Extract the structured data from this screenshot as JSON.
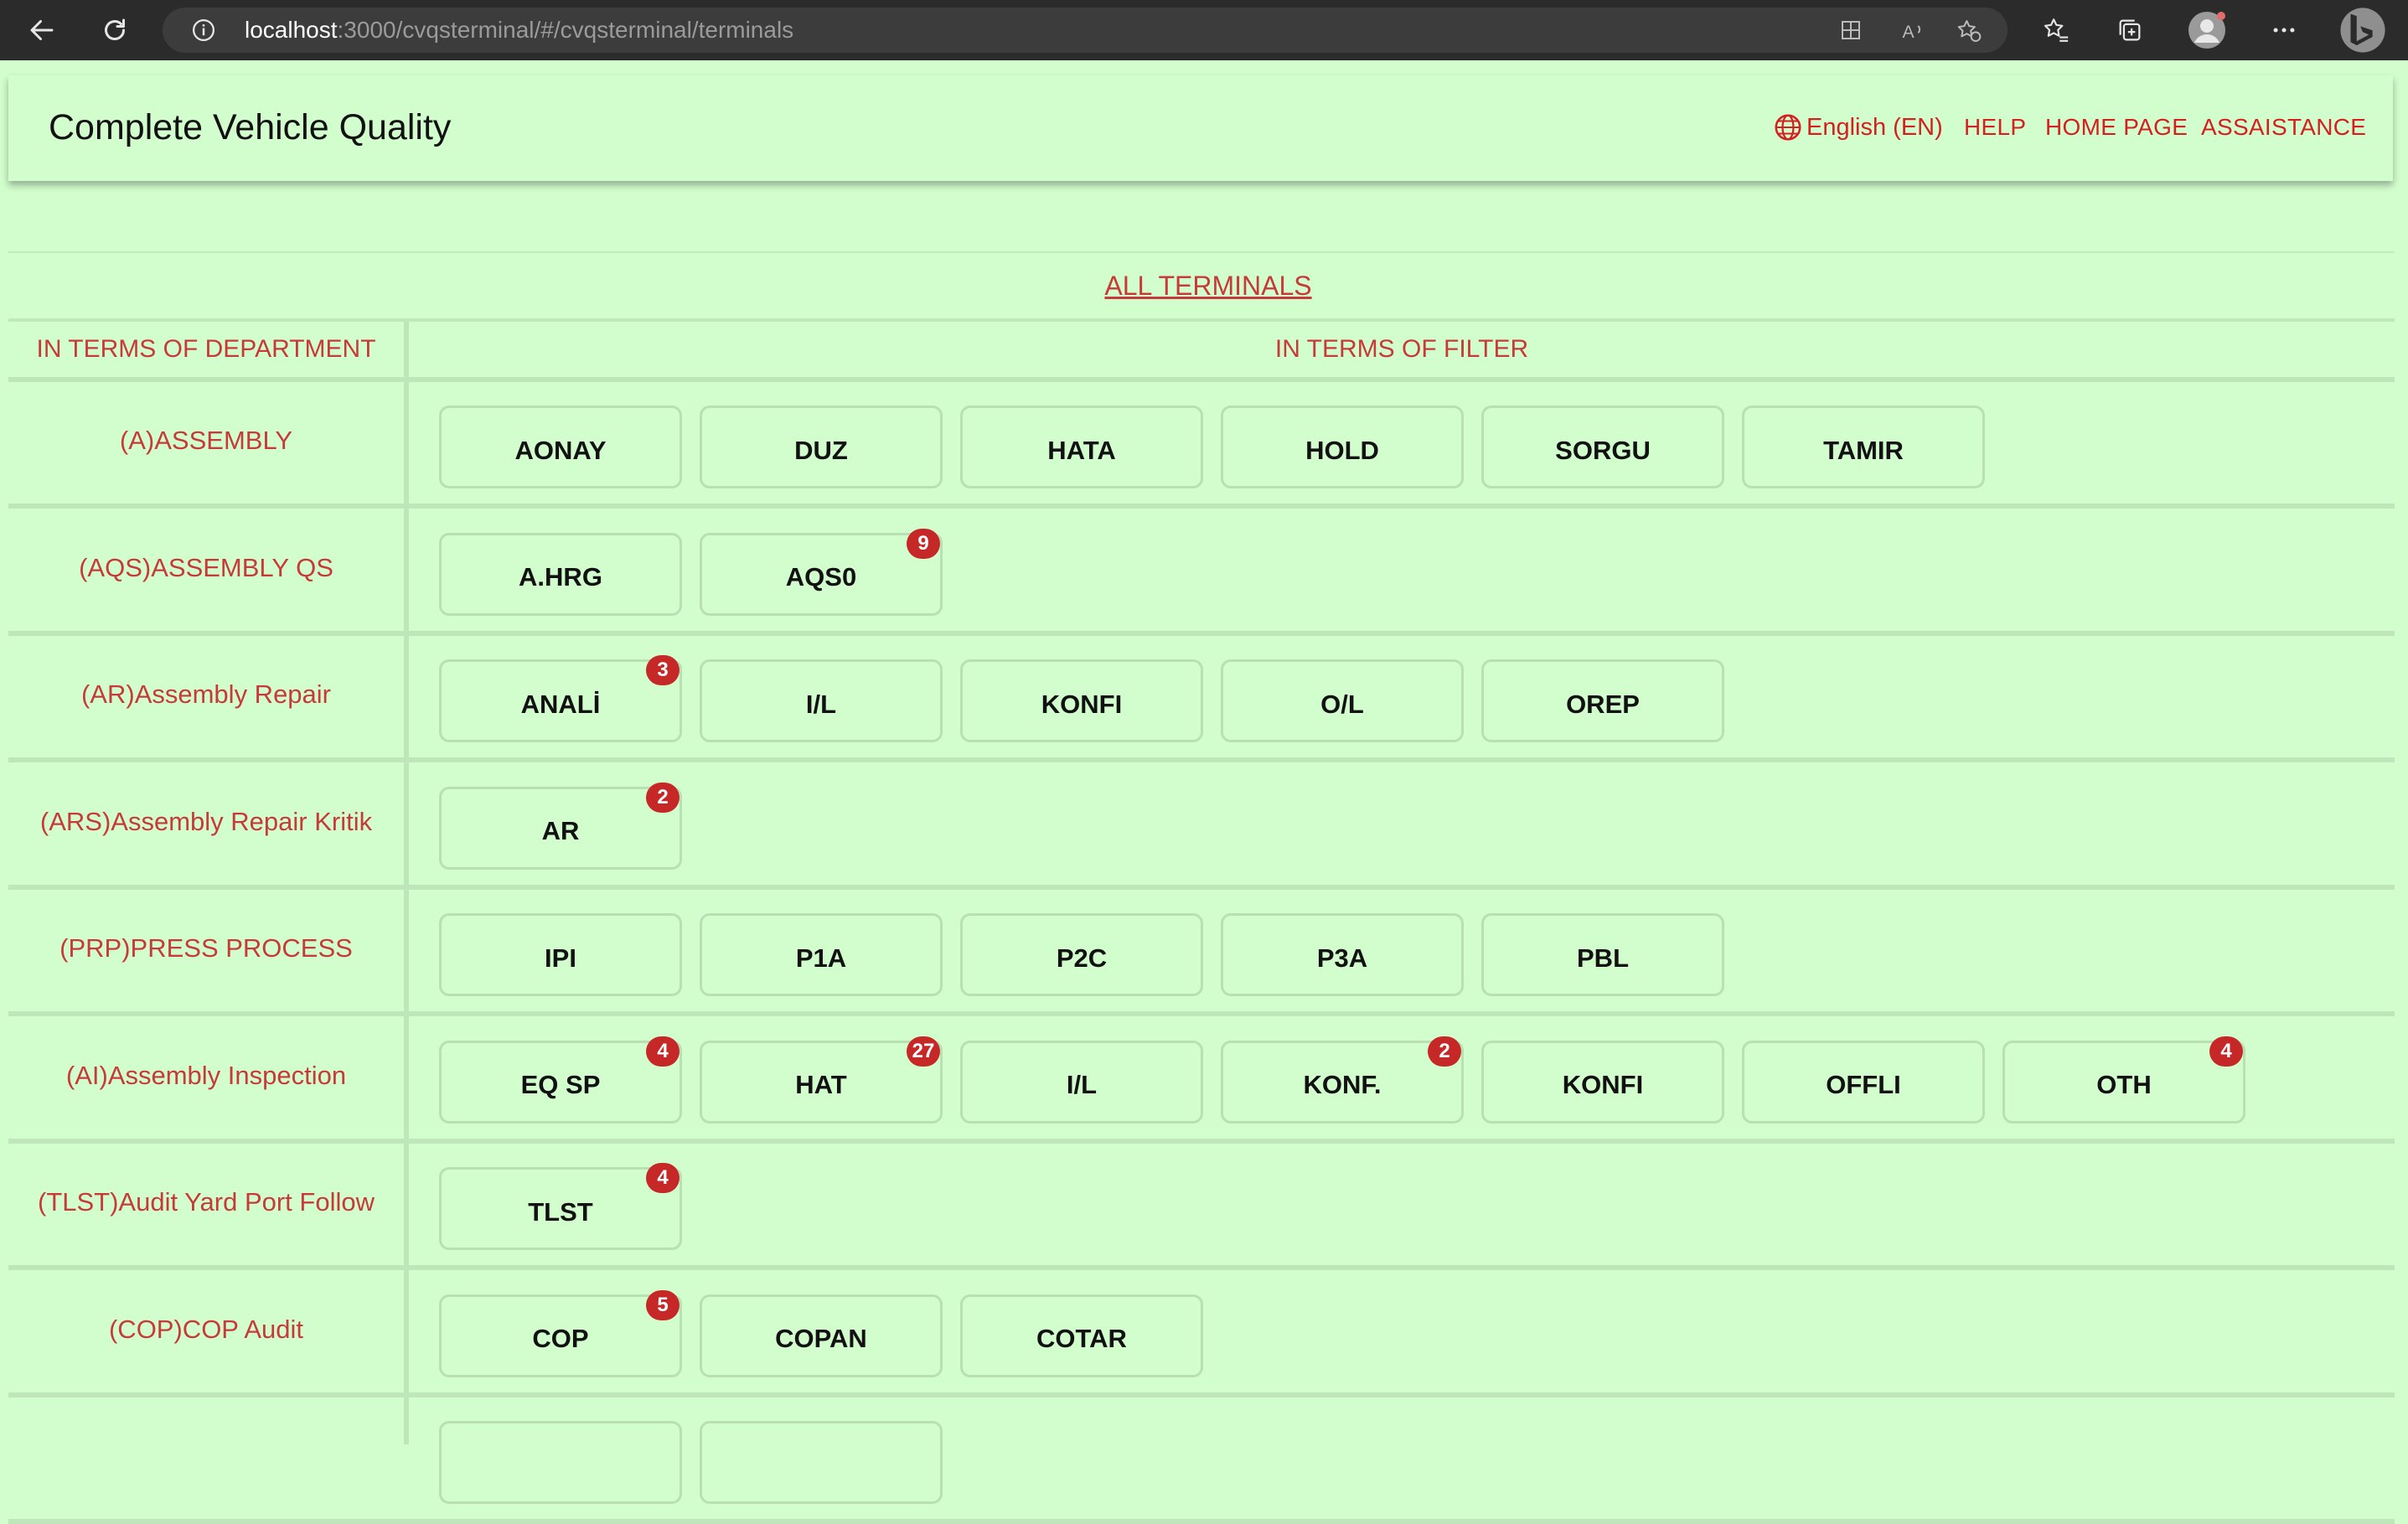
{
  "browser": {
    "url_host": "localhost",
    "url_path": ":3000/cvqsterminal/#/cvqsterminal/terminals"
  },
  "header": {
    "title": "Complete Vehicle Quality",
    "language": "English (EN)",
    "help": "HELP",
    "home": "HOME PAGE",
    "assistance": "ASSAISTANCE"
  },
  "table": {
    "all_terminals": "ALL TERMINALS",
    "col_department": "IN TERMS OF DEPARTMENT",
    "col_filter": "IN TERMS OF FILTER",
    "departments": [
      {
        "name": "(A)ASSEMBLY",
        "terminals": [
          {
            "label": "AONAY",
            "badge": ""
          },
          {
            "label": "DUZ",
            "badge": ""
          },
          {
            "label": "HATA",
            "badge": ""
          },
          {
            "label": "HOLD",
            "badge": ""
          },
          {
            "label": "SORGU",
            "badge": ""
          },
          {
            "label": "TAMIR",
            "badge": ""
          }
        ]
      },
      {
        "name": "(AQS)ASSEMBLY QS",
        "terminals": [
          {
            "label": "A.HRG",
            "badge": ""
          },
          {
            "label": "AQS0",
            "badge": "9"
          }
        ]
      },
      {
        "name": "(AR)Assembly Repair",
        "terminals": [
          {
            "label": "ANALİ",
            "badge": "3"
          },
          {
            "label": "I/L",
            "badge": ""
          },
          {
            "label": "KONFI",
            "badge": ""
          },
          {
            "label": "O/L",
            "badge": ""
          },
          {
            "label": "OREP",
            "badge": ""
          }
        ]
      },
      {
        "name": "(ARS)Assembly Repair Kritik",
        "terminals": [
          {
            "label": "AR",
            "badge": "2"
          }
        ]
      },
      {
        "name": "(PRP)PRESS PROCESS",
        "terminals": [
          {
            "label": "IPI",
            "badge": ""
          },
          {
            "label": "P1A",
            "badge": ""
          },
          {
            "label": "P2C",
            "badge": ""
          },
          {
            "label": "P3A",
            "badge": ""
          },
          {
            "label": "PBL",
            "badge": ""
          }
        ]
      },
      {
        "name": "(AI)Assembly Inspection",
        "terminals": [
          {
            "label": "EQ SP",
            "badge": "4"
          },
          {
            "label": "HAT",
            "badge": "27"
          },
          {
            "label": "I/L",
            "badge": ""
          },
          {
            "label": "KONF.",
            "badge": "2"
          },
          {
            "label": "KONFI",
            "badge": ""
          },
          {
            "label": "OFFLI",
            "badge": ""
          },
          {
            "label": "OTH",
            "badge": "4"
          }
        ]
      },
      {
        "name": "(TLST)Audit Yard Port Follow",
        "terminals": [
          {
            "label": "TLST",
            "badge": "4"
          }
        ]
      },
      {
        "name": "(COP)COP Audit",
        "terminals": [
          {
            "label": "COP",
            "badge": "5"
          },
          {
            "label": "COPAN",
            "badge": ""
          },
          {
            "label": "COTAR",
            "badge": ""
          }
        ]
      }
    ]
  }
}
